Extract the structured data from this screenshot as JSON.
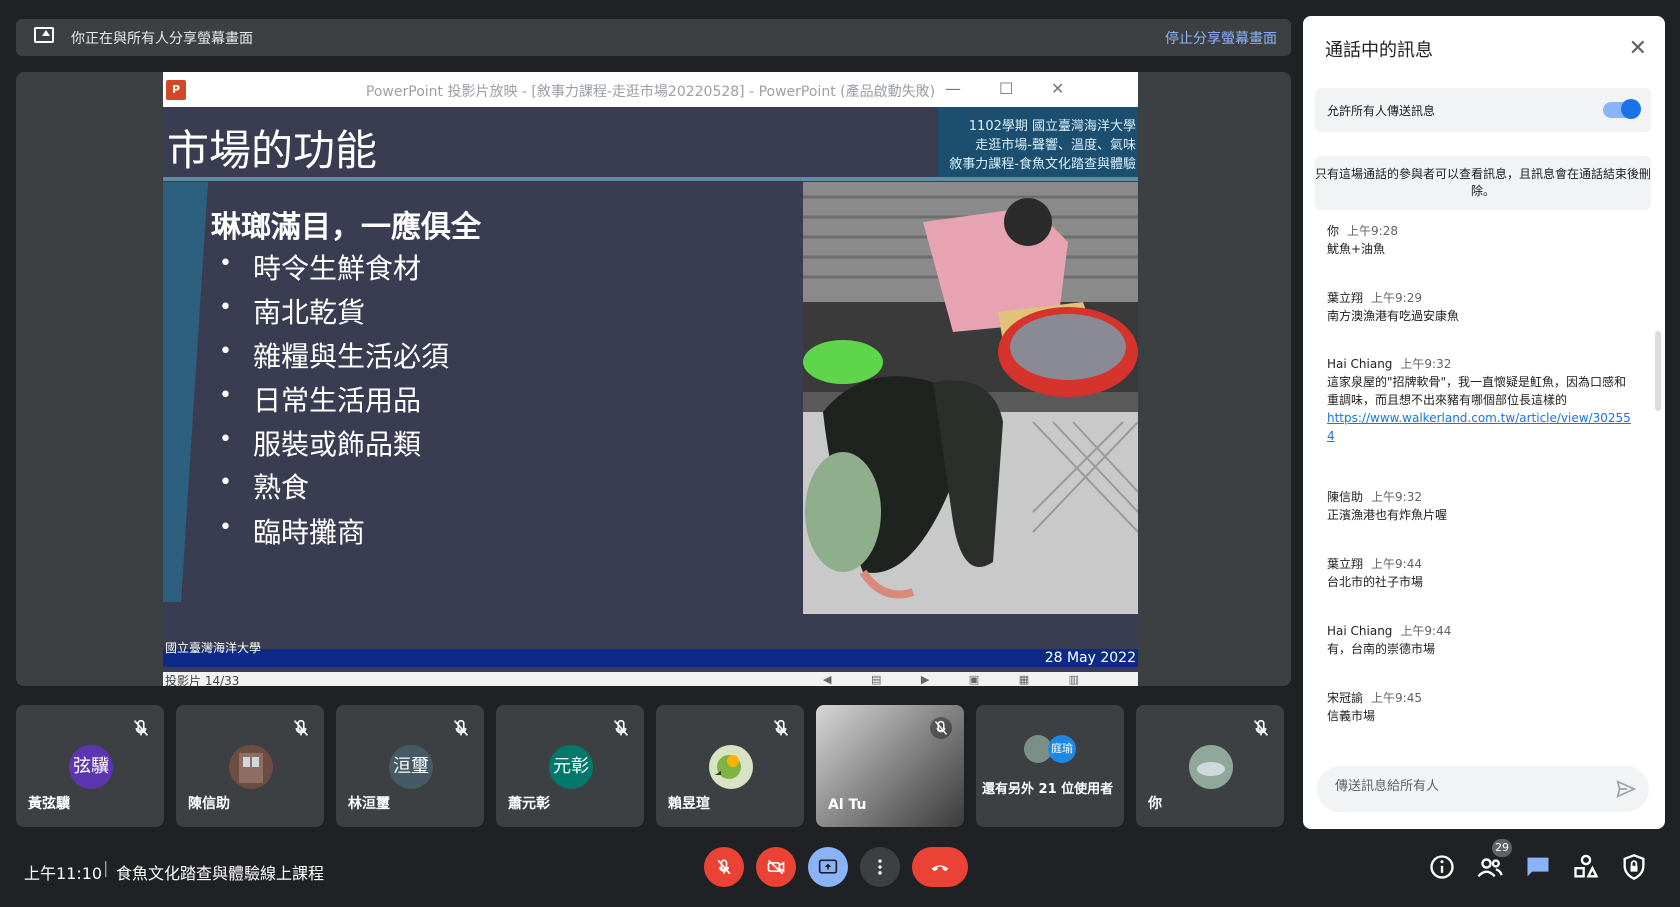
{
  "banner": {
    "text": "你正在與所有人分享螢幕畫面",
    "stop": "停止分享螢幕畫面"
  },
  "ppt": {
    "window_title": "PowerPoint 投影片放映 - [敘事力課程-走逛市場20220528] - PowerPoint (產品啟動失敗)",
    "slide_title": "市場的功能",
    "course_lines": [
      "1102學期 國立臺灣海洋大學",
      "走逛市場-聲響、溫度、氣味",
      "敘事力課程-食魚文化踏查與體驗"
    ],
    "bullet_head": "琳瑯滿目，一應俱全",
    "bullets": [
      "時令生鮮食材",
      "南北乾貨",
      "雜糧與生活必須",
      "日常生活用品",
      "服裝或飾品類",
      "熟食",
      "臨時攤商"
    ],
    "date": "28 May 2022",
    "footer_logo": "國立臺灣海洋大學",
    "status": "投影片 14/33"
  },
  "tiles": [
    {
      "name": "黃弦驥",
      "avatar_text": "弦驥",
      "color": "#5e35b1"
    },
    {
      "name": "陳信助",
      "avatar_text": "",
      "color": "#6d4c41"
    },
    {
      "name": "林洹璽",
      "avatar_text": "洹璽",
      "color": "#455a64"
    },
    {
      "name": "蕭元彰",
      "avatar_text": "元彰",
      "color": "#00796b"
    },
    {
      "name": "賴昱瑄",
      "avatar_text": "",
      "color": "#7cb342"
    },
    {
      "name": "Al Tu",
      "avatar_text": "",
      "color": "#777"
    },
    {
      "name": "還有另外 21 位使用者",
      "avatar_text": "庭瑜",
      "color": "#1e88e5"
    },
    {
      "name": "你",
      "avatar_text": "",
      "color": "#607d8b"
    }
  ],
  "bottom": {
    "time": "上午11:10",
    "meeting": "食魚文化踏查與體驗線上課程",
    "people_count": "29"
  },
  "chat": {
    "title": "通話中的訊息",
    "allow_label": "允許所有人傳送訊息",
    "notice": "只有這場通話的參與者可以查看訊息，且訊息會在通話結束後刪除。",
    "messages": [
      {
        "who": "你",
        "time": "上午9:28",
        "body": "魷魚+油魚"
      },
      {
        "who": "葉立翔",
        "time": "上午9:29",
        "body": "南方澳漁港有吃過安康魚"
      },
      {
        "who": "Hai Chiang",
        "time": "上午9:32",
        "body": "這家泉屋的\"招牌軟骨\"，我一直懷疑是魟魚，因為口感和重調味，而且想不出來豬有哪個部位長這樣的",
        "link": "https://www.walkerland.com.tw/article/view/302554"
      },
      {
        "who": "陳信助",
        "time": "上午9:32",
        "body": "正濱漁港也有炸魚片喔"
      },
      {
        "who": "葉立翔",
        "time": "上午9:44",
        "body": "台北市的社子市場"
      },
      {
        "who": "Hai Chiang",
        "time": "上午9:44",
        "body": "有，台南的崇德市場"
      },
      {
        "who": "宋冠諭",
        "time": "上午9:45",
        "body": "信義市場"
      }
    ],
    "input_placeholder": "傳送訊息給所有人"
  }
}
